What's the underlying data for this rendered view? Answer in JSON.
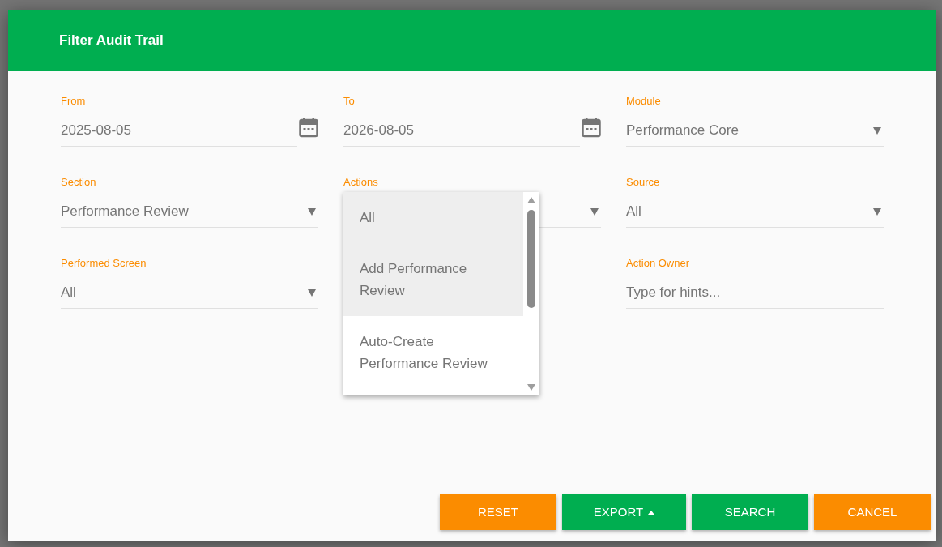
{
  "dialog": {
    "title": "Filter Audit Trail",
    "fields": [
      {
        "kind": "date",
        "label": "From",
        "value": "2025-08-05"
      },
      {
        "kind": "date",
        "label": "To",
        "value": "2026-08-05"
      },
      {
        "kind": "select",
        "label": "Module",
        "value": "Performance Core"
      },
      {
        "kind": "select",
        "label": "Section",
        "value": "Performance Review"
      },
      {
        "kind": "select",
        "label": "Actions"
      },
      {
        "kind": "select",
        "label": "Source",
        "value": "All"
      },
      {
        "kind": "select",
        "label": "Performed Screen",
        "value": "All"
      },
      {
        "kind": "covered"
      },
      {
        "kind": "text",
        "label": "Action Owner",
        "placeholder": "Type for hints..."
      }
    ],
    "dropdown": {
      "options": [
        {
          "label": "All",
          "selected": true
        },
        {
          "label": "Add Performance Review",
          "selected": true
        },
        {
          "label": "Auto-Create Performance Review",
          "selected": false
        }
      ]
    },
    "buttons": [
      {
        "label": "RESET",
        "kind": "warning",
        "menu": false
      },
      {
        "label": "EXPORT",
        "kind": "primary",
        "menu": true
      },
      {
        "label": "SEARCH",
        "kind": "primary",
        "menu": false
      },
      {
        "label": "CANCEL",
        "kind": "warning",
        "menu": false
      }
    ]
  }
}
